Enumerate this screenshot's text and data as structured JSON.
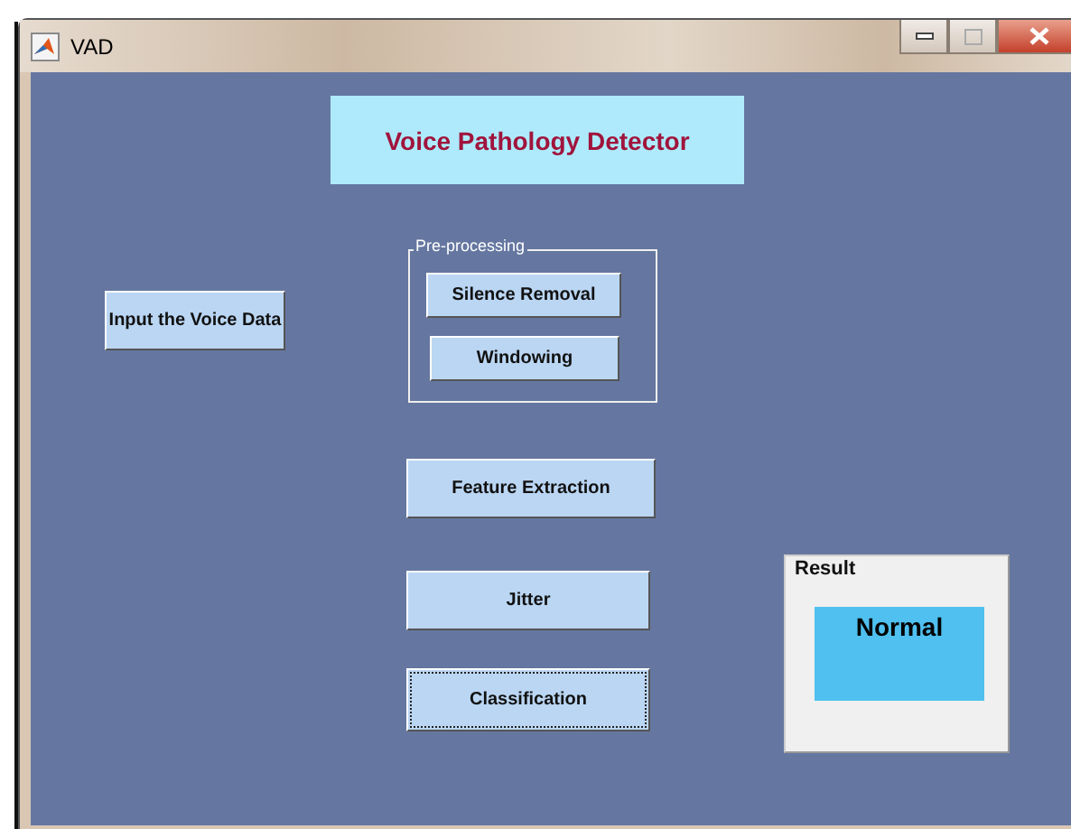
{
  "window": {
    "title": "VAD"
  },
  "heading": "Voice Pathology Detector",
  "input_button": {
    "label": "Input the Voice Data",
    "focused": false
  },
  "preprocessing": {
    "title": "Pre-processing",
    "buttons": [
      {
        "label": "Silence Removal",
        "focused": false
      },
      {
        "label": "Windowing",
        "focused": false
      }
    ]
  },
  "buttons": [
    {
      "label": "Feature Extraction",
      "focused": false
    },
    {
      "label": "Jitter",
      "focused": false
    },
    {
      "label": "Classification",
      "focused": true
    }
  ],
  "result": {
    "title": "Result",
    "value": "Normal"
  }
}
